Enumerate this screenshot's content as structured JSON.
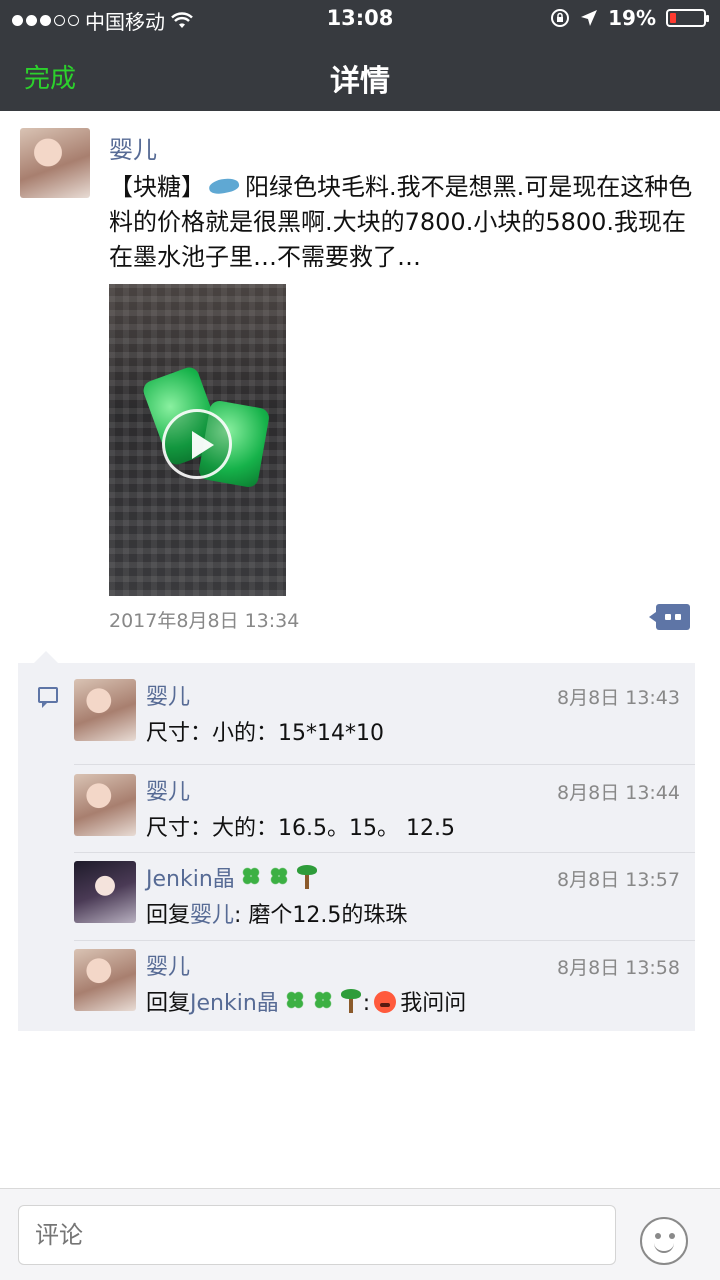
{
  "status_bar": {
    "carrier": "中国移动",
    "time": "13:08",
    "battery": "19%",
    "battery_level": 0.19
  },
  "nav": {
    "done_label": "完成",
    "title": "详情"
  },
  "post": {
    "author": "婴儿",
    "text_prefix": "【块糖】",
    "text_main": "阳绿色块毛料.我不是想黑.可是现在这种色料的价格就是很黑啊.大块的7800.小块的5800.我现在在墨水池子里…不需要救了…",
    "timestamp": "2017年8月8日 13:34"
  },
  "comments": [
    {
      "name": "婴儿",
      "time": "8月8日 13:43",
      "text": "尺寸：小的：15*14*10"
    },
    {
      "name": "婴儿",
      "time": "8月8日 13:44",
      "text": "尺寸：大的：16.5。15。 12.5"
    },
    {
      "name": "Jenkin晶",
      "time": "8月8日 13:57",
      "reply_prefix": "回复",
      "reply_to": "婴儿",
      "text": ": 磨个12.5的珠珠"
    },
    {
      "name": "婴儿",
      "time": "8月8日 13:58",
      "reply_prefix": "回复",
      "reply_to": "Jenkin晶",
      "text": "我问问"
    }
  ],
  "comment_input": {
    "placeholder": "评论"
  },
  "colors": {
    "nav_bg": "#373a3f",
    "done_green": "#2cd12c",
    "name_blue": "#576b95",
    "comment_bg": "#f0f1f5"
  }
}
